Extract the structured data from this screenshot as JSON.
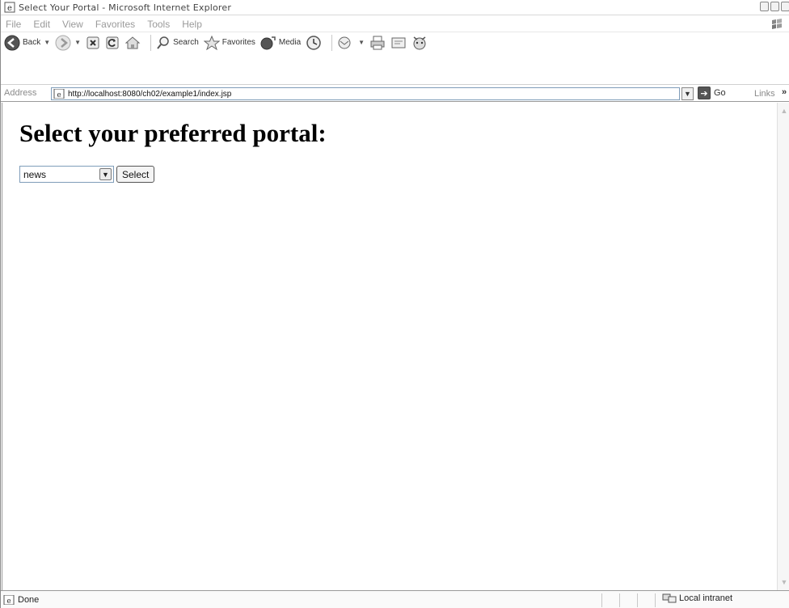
{
  "window": {
    "title": "Select Your Portal - Microsoft Internet Explorer"
  },
  "menu": {
    "items": [
      "File",
      "Edit",
      "View",
      "Favorites",
      "Tools",
      "Help"
    ]
  },
  "toolbar": {
    "back_label": "Back",
    "search_label": "Search",
    "favorites_label": "Favorites",
    "media_label": "Media"
  },
  "address": {
    "label": "Address",
    "url": "http://localhost:8080/ch02/example1/index.jsp",
    "go_label": "Go",
    "links_label": "Links",
    "links_more": "»"
  },
  "page": {
    "heading": "Select your preferred portal:",
    "portal_select": {
      "selected": "news"
    },
    "submit_label": "Select"
  },
  "status": {
    "text": "Done",
    "zone": "Local intranet"
  },
  "icons": {
    "page": "ie-page-icon",
    "back": "back-arrow-icon",
    "forward": "forward-arrow-icon",
    "stop": "stop-icon",
    "refresh": "refresh-icon",
    "home": "home-icon",
    "search": "search-icon",
    "favorites": "favorites-star-icon",
    "media": "media-icon",
    "history": "history-icon",
    "mail": "mail-icon",
    "print": "print-icon",
    "edit": "edit-icon",
    "messenger": "messenger-icon",
    "go": "go-arrow-icon",
    "zone": "local-intranet-icon"
  }
}
